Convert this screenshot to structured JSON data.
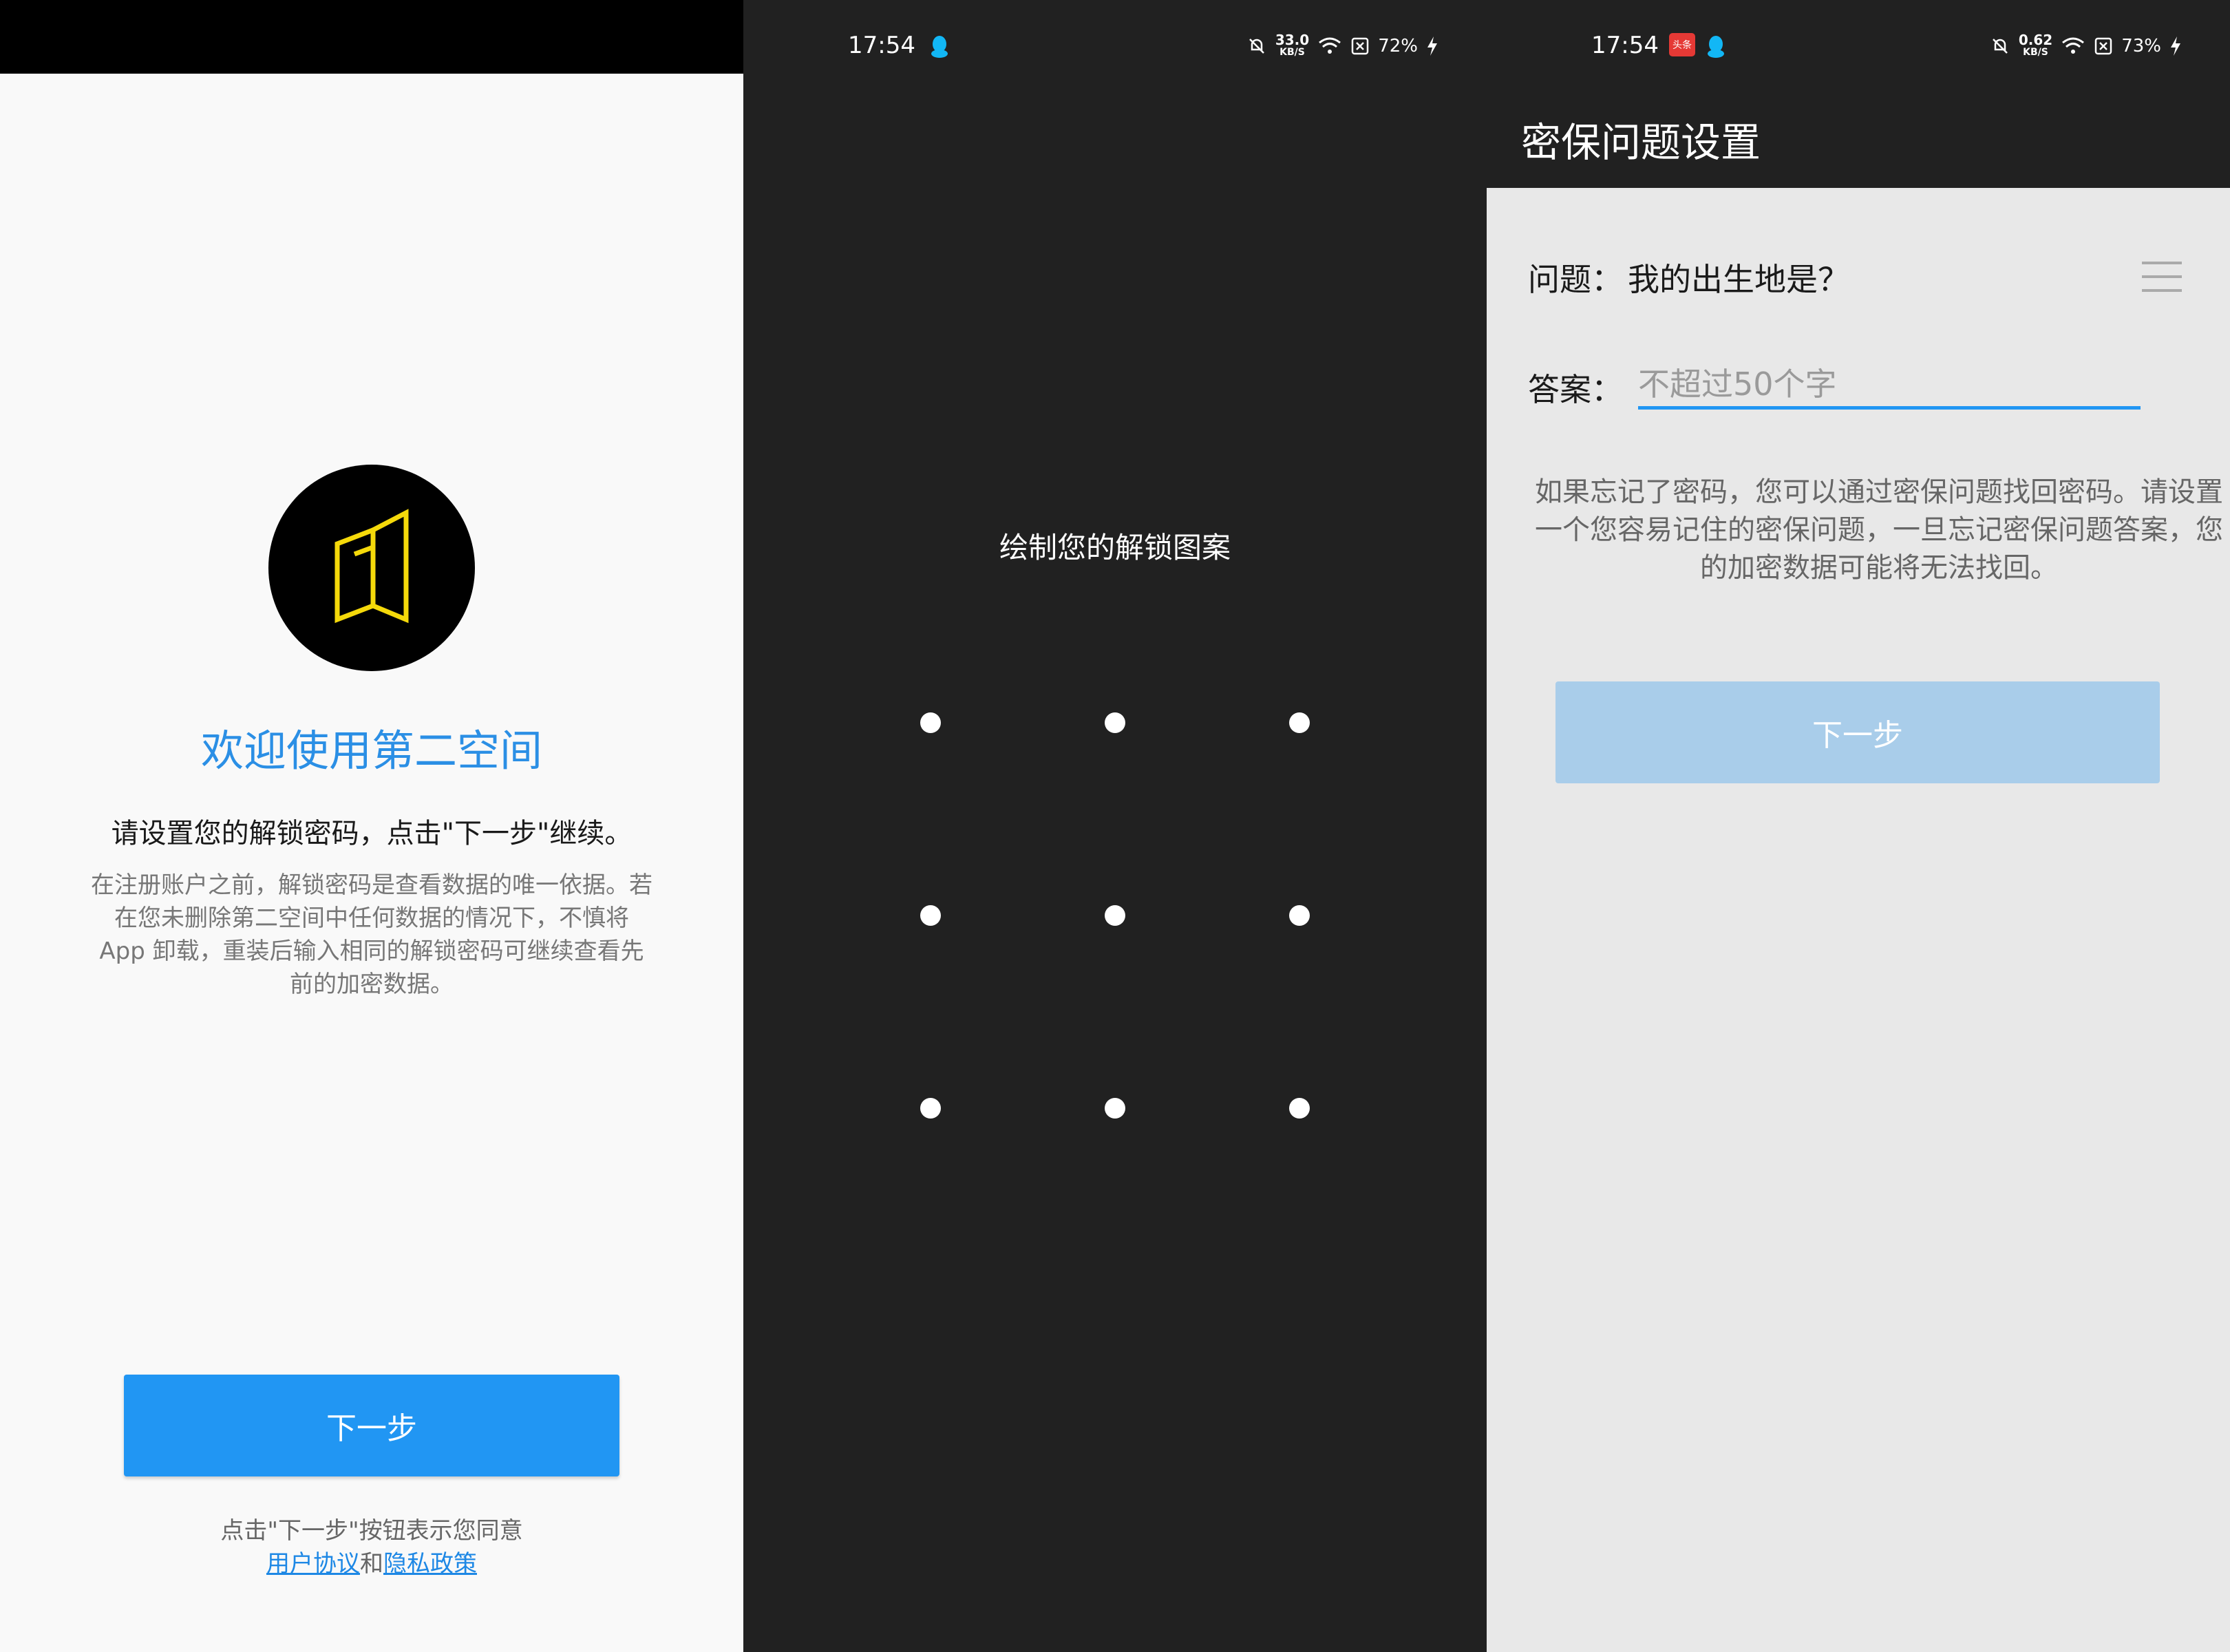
{
  "screen1": {
    "welcome_title": "欢迎使用第二空间",
    "instruction": "请设置您的解锁密码，点击\"下一步\"继续。",
    "description": "在注册账户之前，解锁密码是查看数据的唯一依据。若在您未删除第二空间中任何数据的情况下，不慎将 App 卸载，重装后输入相同的解锁密码可继续查看先前的加密数据。",
    "next_label": "下一步",
    "agree_text": "点击\"下一步\"按钮表示您同意",
    "user_agreement": "用户协议",
    "and_text": "和",
    "privacy_policy": "隐私政策",
    "accent_color": "#2196f3"
  },
  "screen2": {
    "status": {
      "time": "17:54",
      "speed_value": "33.0",
      "speed_unit": "KB/S",
      "battery": "72%"
    },
    "pattern_title": "绘制您的解锁图案"
  },
  "screen3": {
    "status": {
      "time": "17:54",
      "speed_value": "0.62",
      "speed_unit": "KB/S",
      "battery": "73%"
    },
    "title": "密保问题设置",
    "question_label": "问题：",
    "question_value": "我的出生地是？",
    "answer_label": "答案：",
    "answer_placeholder": "不超过50个字",
    "hint": "如果忘记了密码，您可以通过密保问题找回密码。请设置一个您容易记住的密保问题，一旦忘记密保问题答案，您的加密数据可能将无法找回。",
    "next_label": "下一步"
  }
}
